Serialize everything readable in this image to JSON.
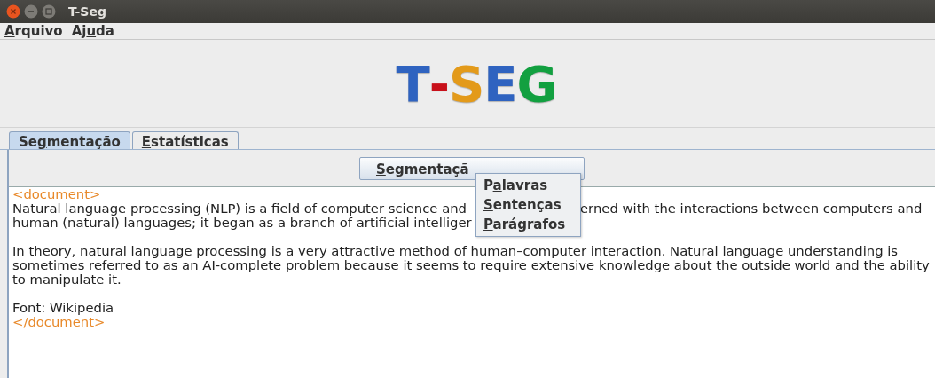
{
  "window": {
    "title": "T-Seg"
  },
  "menu": [
    {
      "key": "A",
      "post": "rquivo"
    },
    {
      "pre": "Aj",
      "key": "u",
      "post": "da"
    }
  ],
  "logo": [
    {
      "text": "T",
      "color": "#2f63c0"
    },
    {
      "text": "-",
      "color": "#c8101a"
    },
    {
      "text": "S",
      "color": "#e39a1a"
    },
    {
      "text": "E",
      "color": "#2f63c0"
    },
    {
      "text": "G",
      "color": "#12a040"
    }
  ],
  "tabs": [
    {
      "pre": "Se",
      "key": "g",
      "post": "mentação",
      "selected": true
    },
    {
      "key": "E",
      "post": "statísticas",
      "selected": false
    }
  ],
  "button": {
    "key": "S",
    "post": "egmentaçã"
  },
  "popup_menu": [
    {
      "pre": "P",
      "key": "a",
      "post": "lavras"
    },
    {
      "key": "S",
      "post": "entenças"
    },
    {
      "key": "P",
      "post": "arágrafos"
    }
  ],
  "editor": [
    {
      "kind": "tag",
      "text": "<document>"
    },
    {
      "kind": "split",
      "left": "Natural language processing (NLP) is a field of computer science and",
      "right": "erned with the interactions between computers and"
    },
    {
      "kind": "split",
      "left": "human (natural) languages; it began as a branch of artificial intelliger"
    },
    {
      "kind": "blank"
    },
    {
      "kind": "text",
      "text": "In theory, natural language processing is a very attractive method of human–computer interaction. Natural language understanding is"
    },
    {
      "kind": "text",
      "text": "sometimes referred to as an AI-complete problem because it seems to require extensive knowledge about the outside world and the ability"
    },
    {
      "kind": "text",
      "text": "to manipulate it."
    },
    {
      "kind": "blank"
    },
    {
      "kind": "text",
      "text": "Font: Wikipedia"
    },
    {
      "kind": "tag",
      "text": "</document>"
    }
  ]
}
